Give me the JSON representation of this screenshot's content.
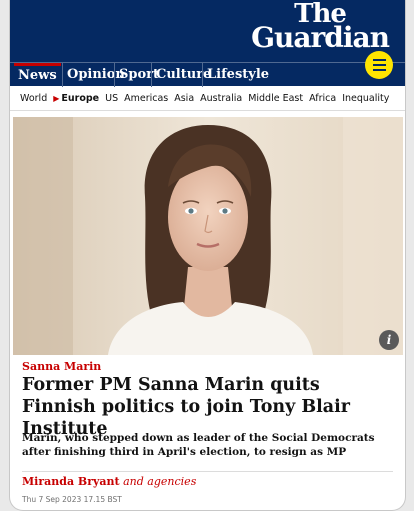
{
  "masthead": {
    "logo_line1": "The",
    "logo_line2": "Guardian"
  },
  "pillars": [
    "News",
    "Opinion",
    "Sport",
    "Culture",
    "Lifestyle"
  ],
  "subnav": [
    "World",
    "Europe",
    "US",
    "Americas",
    "Asia",
    "Australia",
    "Middle East",
    "Africa",
    "Inequality"
  ],
  "subnav_active": "Europe",
  "article": {
    "kicker": "Sanna Marin",
    "headline": "Former PM Sanna Marin quits Finnish politics to join Tony Blair Institute",
    "standfirst": "Marin, who stepped down as leader of the Social Democrats after finishing third in April's election, to resign as MP",
    "byline_name": "Miranda Bryant",
    "byline_suffix": "and agencies",
    "date": "Thu 7 Sep 2023 17.15 BST",
    "info_icon_label": "i"
  },
  "colors": {
    "brand": "#052962",
    "accent": "#c70000",
    "menu": "#ffe500"
  },
  "icons": {
    "menu": "hamburger-icon",
    "info": "info-icon",
    "subnav_marker": "triangle-right-icon"
  }
}
